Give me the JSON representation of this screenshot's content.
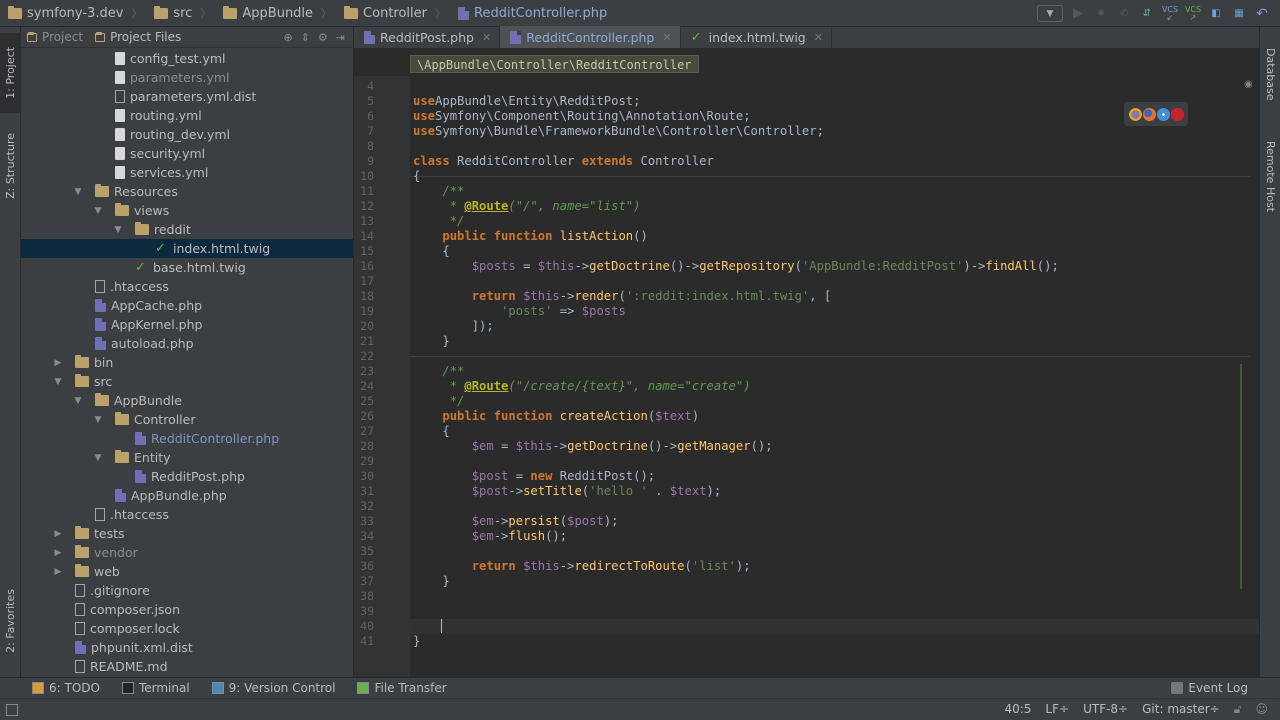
{
  "breadcrumb": [
    "symfony-3.dev",
    "src",
    "AppBundle",
    "Controller",
    "RedditController.php"
  ],
  "project_tabs": {
    "project": "Project",
    "project_files": "Project Files"
  },
  "left_strip": {
    "project": "1: Project",
    "structure": "Z: Structure",
    "favorites": "2: Favorites"
  },
  "right_strip": {
    "database": "Database",
    "remote_host": "Remote Host"
  },
  "tree": [
    {
      "label": "config_test.yml",
      "indent": 5,
      "icon": "yml"
    },
    {
      "label": "parameters.yml",
      "indent": 5,
      "icon": "yml",
      "dim": true
    },
    {
      "label": "parameters.yml.dist",
      "indent": 5,
      "icon": "txt"
    },
    {
      "label": "routing.yml",
      "indent": 5,
      "icon": "yml"
    },
    {
      "label": "routing_dev.yml",
      "indent": 5,
      "icon": "yml"
    },
    {
      "label": "security.yml",
      "indent": 5,
      "icon": "yml"
    },
    {
      "label": "services.yml",
      "indent": 5,
      "icon": "yml"
    },
    {
      "label": "Resources",
      "indent": 4,
      "icon": "folder",
      "open": true
    },
    {
      "label": "views",
      "indent": 5,
      "icon": "folder",
      "open": true
    },
    {
      "label": "reddit",
      "indent": 6,
      "icon": "folder",
      "open": true
    },
    {
      "label": "index.html.twig",
      "indent": 7,
      "icon": "twig",
      "selected": true
    },
    {
      "label": "base.html.twig",
      "indent": 6,
      "icon": "twig"
    },
    {
      "label": ".htaccess",
      "indent": 4,
      "icon": "txt"
    },
    {
      "label": "AppCache.php",
      "indent": 4,
      "icon": "php"
    },
    {
      "label": "AppKernel.php",
      "indent": 4,
      "icon": "php"
    },
    {
      "label": "autoload.php",
      "indent": 4,
      "icon": "php"
    },
    {
      "label": "bin",
      "indent": 3,
      "icon": "folder",
      "open": false
    },
    {
      "label": "src",
      "indent": 3,
      "icon": "folder",
      "open": true
    },
    {
      "label": "AppBundle",
      "indent": 4,
      "icon": "folder",
      "open": true
    },
    {
      "label": "Controller",
      "indent": 5,
      "icon": "folder",
      "open": true
    },
    {
      "label": "RedditController.php",
      "indent": 6,
      "icon": "php",
      "blue": true
    },
    {
      "label": "Entity",
      "indent": 5,
      "icon": "folder",
      "open": true
    },
    {
      "label": "RedditPost.php",
      "indent": 6,
      "icon": "php"
    },
    {
      "label": "AppBundle.php",
      "indent": 5,
      "icon": "php"
    },
    {
      "label": ".htaccess",
      "indent": 4,
      "icon": "txt"
    },
    {
      "label": "tests",
      "indent": 3,
      "icon": "folder",
      "open": false
    },
    {
      "label": "vendor",
      "indent": 3,
      "icon": "folder",
      "open": false,
      "dim": true
    },
    {
      "label": "web",
      "indent": 3,
      "icon": "folder",
      "open": false
    },
    {
      "label": ".gitignore",
      "indent": 3,
      "icon": "txt"
    },
    {
      "label": "composer.json",
      "indent": 3,
      "icon": "txt"
    },
    {
      "label": "composer.lock",
      "indent": 3,
      "icon": "txt"
    },
    {
      "label": "phpunit.xml.dist",
      "indent": 3,
      "icon": "php"
    },
    {
      "label": "README.md",
      "indent": 3,
      "icon": "txt"
    }
  ],
  "editor_tabs": [
    {
      "label": "RedditPost.php",
      "active": false
    },
    {
      "label": "RedditController.php",
      "active": true
    },
    {
      "label": "index.html.twig",
      "active": false
    }
  ],
  "namespace_breadcrumb": "\\AppBundle\\Controller\\RedditController",
  "code": [
    {
      "n": "4",
      "t": []
    },
    {
      "n": "5",
      "t": [
        [
          "kw",
          "use"
        ],
        [
          "",
          "AppBundle\\Entity\\RedditPost;"
        ]
      ]
    },
    {
      "n": "6",
      "t": [
        [
          "kw",
          "use"
        ],
        [
          "",
          "Symfony\\Component\\Routing\\Annotation\\Route;"
        ]
      ]
    },
    {
      "n": "7",
      "t": [
        [
          "kw",
          "use"
        ],
        [
          "",
          "Symfony\\Bundle\\FrameworkBundle\\Controller\\Controller;"
        ]
      ]
    },
    {
      "n": "8",
      "t": []
    },
    {
      "n": "9",
      "t": [
        [
          "kw",
          "class"
        ],
        [
          "",
          " RedditController "
        ],
        [
          "kw",
          "extends"
        ],
        [
          "",
          " Controller"
        ]
      ]
    },
    {
      "n": "10",
      "t": [
        [
          "",
          "{"
        ]
      ]
    },
    {
      "n": "11",
      "t": [
        [
          "",
          "    "
        ],
        [
          "cm",
          "/**"
        ]
      ]
    },
    {
      "n": "12",
      "t": [
        [
          "",
          "    "
        ],
        [
          "cm",
          " * "
        ],
        [
          "ann",
          "@Route"
        ],
        [
          "cm",
          "(\"/\", name=\"list\")"
        ]
      ]
    },
    {
      "n": "13",
      "t": [
        [
          "",
          "    "
        ],
        [
          "cm",
          " */"
        ]
      ]
    },
    {
      "n": "14",
      "t": [
        [
          "",
          "    "
        ],
        [
          "kw",
          "public function"
        ],
        [
          "",
          " "
        ],
        [
          "fn",
          "listAction"
        ],
        [
          "",
          "()"
        ]
      ]
    },
    {
      "n": "15",
      "t": [
        [
          "",
          "    {"
        ]
      ]
    },
    {
      "n": "16",
      "t": [
        [
          "",
          "        "
        ],
        [
          "var",
          "$posts"
        ],
        [
          "",
          " = "
        ],
        [
          "var",
          "$this"
        ],
        [
          "",
          "->"
        ],
        [
          "fn",
          "getDoctrine"
        ],
        [
          "",
          "()->"
        ],
        [
          "fn",
          "getRepository"
        ],
        [
          "",
          "("
        ],
        [
          "str",
          "'AppBundle:RedditPost'"
        ],
        [
          "",
          ")->"
        ],
        [
          "fn",
          "findAll"
        ],
        [
          "",
          "();"
        ]
      ]
    },
    {
      "n": "17",
      "t": []
    },
    {
      "n": "18",
      "t": [
        [
          "",
          "        "
        ],
        [
          "kw",
          "return"
        ],
        [
          "",
          " "
        ],
        [
          "var",
          "$this"
        ],
        [
          "",
          "->"
        ],
        [
          "fn",
          "render"
        ],
        [
          "",
          "("
        ],
        [
          "str",
          "':reddit:index.html.twig'"
        ],
        [
          "",
          ", ["
        ]
      ]
    },
    {
      "n": "19",
      "t": [
        [
          "",
          "            "
        ],
        [
          "str",
          "'posts'"
        ],
        [
          "",
          " => "
        ],
        [
          "var",
          "$posts"
        ]
      ]
    },
    {
      "n": "20",
      "t": [
        [
          "",
          "        ]);"
        ]
      ]
    },
    {
      "n": "21",
      "t": [
        [
          "",
          "    }"
        ]
      ]
    },
    {
      "n": "22",
      "t": []
    },
    {
      "n": "23",
      "t": [
        [
          "",
          "    "
        ],
        [
          "cm",
          "/**"
        ]
      ]
    },
    {
      "n": "24",
      "t": [
        [
          "",
          "    "
        ],
        [
          "cm",
          " * "
        ],
        [
          "ann",
          "@Route"
        ],
        [
          "cm",
          "(\"/create/{text}\", name=\"create\")"
        ]
      ]
    },
    {
      "n": "25",
      "t": [
        [
          "",
          "    "
        ],
        [
          "cm",
          " */"
        ]
      ]
    },
    {
      "n": "26",
      "t": [
        [
          "",
          "    "
        ],
        [
          "kw",
          "public function"
        ],
        [
          "",
          " "
        ],
        [
          "fn",
          "createAction"
        ],
        [
          "",
          "("
        ],
        [
          "var",
          "$text"
        ],
        [
          "",
          ")"
        ]
      ]
    },
    {
      "n": "27",
      "t": [
        [
          "",
          "    {"
        ]
      ]
    },
    {
      "n": "28",
      "t": [
        [
          "",
          "        "
        ],
        [
          "var",
          "$em"
        ],
        [
          "",
          " = "
        ],
        [
          "var",
          "$this"
        ],
        [
          "",
          "->"
        ],
        [
          "fn",
          "getDoctrine"
        ],
        [
          "",
          "()->"
        ],
        [
          "fn",
          "getManager"
        ],
        [
          "",
          "();"
        ]
      ]
    },
    {
      "n": "29",
      "t": []
    },
    {
      "n": "30",
      "t": [
        [
          "",
          "        "
        ],
        [
          "var",
          "$post"
        ],
        [
          "",
          " = "
        ],
        [
          "kw",
          "new"
        ],
        [
          "",
          " RedditPost();"
        ]
      ]
    },
    {
      "n": "31",
      "t": [
        [
          "",
          "        "
        ],
        [
          "var",
          "$post"
        ],
        [
          "",
          "->"
        ],
        [
          "fn",
          "setTitle"
        ],
        [
          "",
          "("
        ],
        [
          "str",
          "'hello '"
        ],
        [
          "",
          " . "
        ],
        [
          "var",
          "$text"
        ],
        [
          "",
          ");"
        ]
      ]
    },
    {
      "n": "32",
      "t": []
    },
    {
      "n": "33",
      "t": [
        [
          "",
          "        "
        ],
        [
          "var",
          "$em"
        ],
        [
          "",
          "->"
        ],
        [
          "fn",
          "persist"
        ],
        [
          "",
          "("
        ],
        [
          "var",
          "$post"
        ],
        [
          "",
          ");"
        ]
      ]
    },
    {
      "n": "34",
      "t": [
        [
          "",
          "        "
        ],
        [
          "var",
          "$em"
        ],
        [
          "",
          "->"
        ],
        [
          "fn",
          "flush"
        ],
        [
          "",
          "();"
        ]
      ]
    },
    {
      "n": "35",
      "t": []
    },
    {
      "n": "36",
      "t": [
        [
          "",
          "        "
        ],
        [
          "kw",
          "return"
        ],
        [
          "",
          " "
        ],
        [
          "var",
          "$this"
        ],
        [
          "",
          "->"
        ],
        [
          "fn",
          "redirectToRoute"
        ],
        [
          "",
          "("
        ],
        [
          "str",
          "'list'"
        ],
        [
          "",
          ");"
        ]
      ]
    },
    {
      "n": "37",
      "t": [
        [
          "",
          "    }"
        ]
      ]
    },
    {
      "n": "38",
      "t": []
    },
    {
      "n": "39",
      "t": []
    },
    {
      "n": "40",
      "t": [
        [
          "",
          "    "
        ]
      ]
    },
    {
      "n": "41",
      "t": [
        [
          "",
          "}"
        ]
      ]
    }
  ],
  "bottom_tabs": [
    {
      "label": "6: TODO"
    },
    {
      "label": "Terminal"
    },
    {
      "label": "9: Version Control"
    },
    {
      "label": "File Transfer"
    }
  ],
  "event_log": "Event Log",
  "status": {
    "position": "40:5",
    "line_sep": "LF÷",
    "encoding": "UTF-8÷",
    "git": "Git: master÷"
  },
  "vcs_labels": [
    "VCS",
    "VCS"
  ],
  "colors": {
    "keyword": "#cc7832",
    "variable": "#9876aa",
    "function": "#ffc66d",
    "string": "#6a8759",
    "comment": "#629755",
    "annotation": "#bbb529"
  }
}
